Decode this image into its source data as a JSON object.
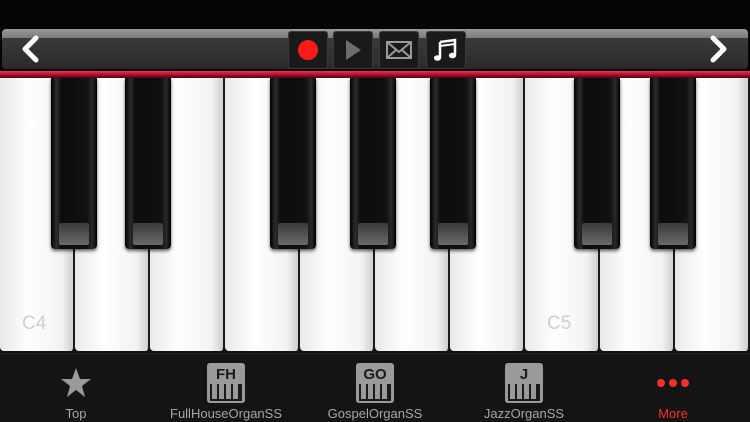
{
  "toolbar": {
    "back_icon": "chevron-left-icon",
    "forward_icon": "chevron-right-icon",
    "record_icon": "record-icon",
    "play_icon": "play-icon",
    "mail_icon": "envelope-icon",
    "music_icon": "music-notes-icon",
    "accent_color": "#ff1a1a",
    "strip_color": "#c0143c"
  },
  "keyboard": {
    "white_keys": [
      "C4",
      "D4",
      "E4",
      "F4",
      "G4",
      "A4",
      "B4",
      "C5",
      "D5",
      "E5"
    ],
    "visible_labels": {
      "c4": "C4",
      "c5": "C5"
    }
  },
  "tabbar": {
    "items": [
      {
        "label": "Top",
        "icon": "star-icon",
        "active": false
      },
      {
        "label": "FullHouseOrganSS",
        "badge": "FH",
        "icon": "organ-fh-icon",
        "active": false
      },
      {
        "label": "GospelOrganSS",
        "badge": "GO",
        "icon": "organ-go-icon",
        "active": false
      },
      {
        "label": "JazzOrganSS",
        "badge": "J",
        "icon": "organ-j-icon",
        "active": false
      },
      {
        "label": "More",
        "icon": "more-dots-icon",
        "active": true
      }
    ],
    "active_color": "#ff2d2d"
  }
}
